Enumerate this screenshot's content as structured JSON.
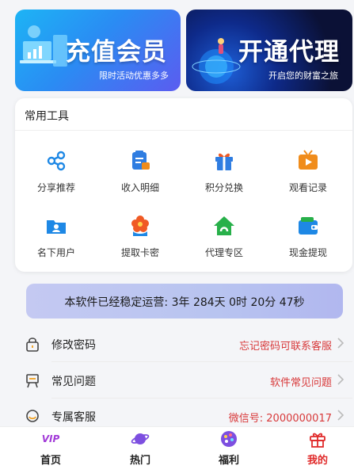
{
  "banners": {
    "vip": {
      "title": "充值会员",
      "subtitle": "限时活动优惠多多"
    },
    "agent": {
      "title": "开通代理",
      "subtitle": "开启您的财富之旅"
    }
  },
  "tools": {
    "title": "常用工具",
    "items": [
      {
        "label": "分享推荐",
        "icon": "share-icon",
        "color": "#1e88e5"
      },
      {
        "label": "收入明细",
        "icon": "income-detail-icon",
        "color": "#2f7de1"
      },
      {
        "label": "积分兑换",
        "icon": "gift-icon",
        "color": "#2f7de1"
      },
      {
        "label": "观看记录",
        "icon": "play-history-icon",
        "color": "#f08c1b"
      },
      {
        "label": "名下用户",
        "icon": "users-folder-icon",
        "color": "#1e88e5"
      },
      {
        "label": "提取卡密",
        "icon": "flower-icon",
        "color": "#f05a24"
      },
      {
        "label": "代理专区",
        "icon": "agent-house-icon",
        "color": "#28b04a"
      },
      {
        "label": "现金提现",
        "icon": "wallet-icon",
        "color": "#1e88e5"
      }
    ]
  },
  "runtime": {
    "text": "本软件已经稳定运营: 3年 284天 0时 20分 47秒"
  },
  "list": [
    {
      "label": "修改密码",
      "value": "忘记密码可联系客服",
      "icon": "lock-icon"
    },
    {
      "label": "常见问题",
      "value": "软件常见问题",
      "icon": "easel-icon"
    },
    {
      "label": "专属客服",
      "value": "微信号: 2000000017",
      "icon": "chat-icon"
    }
  ],
  "nav": {
    "items": [
      {
        "label": "首页",
        "icon": "vip-icon"
      },
      {
        "label": "热门",
        "icon": "planet-icon"
      },
      {
        "label": "福利",
        "icon": "palette-icon"
      },
      {
        "label": "我的",
        "icon": "gift-box-icon"
      }
    ],
    "active_index": 3,
    "active_color": "#e02a2a"
  }
}
